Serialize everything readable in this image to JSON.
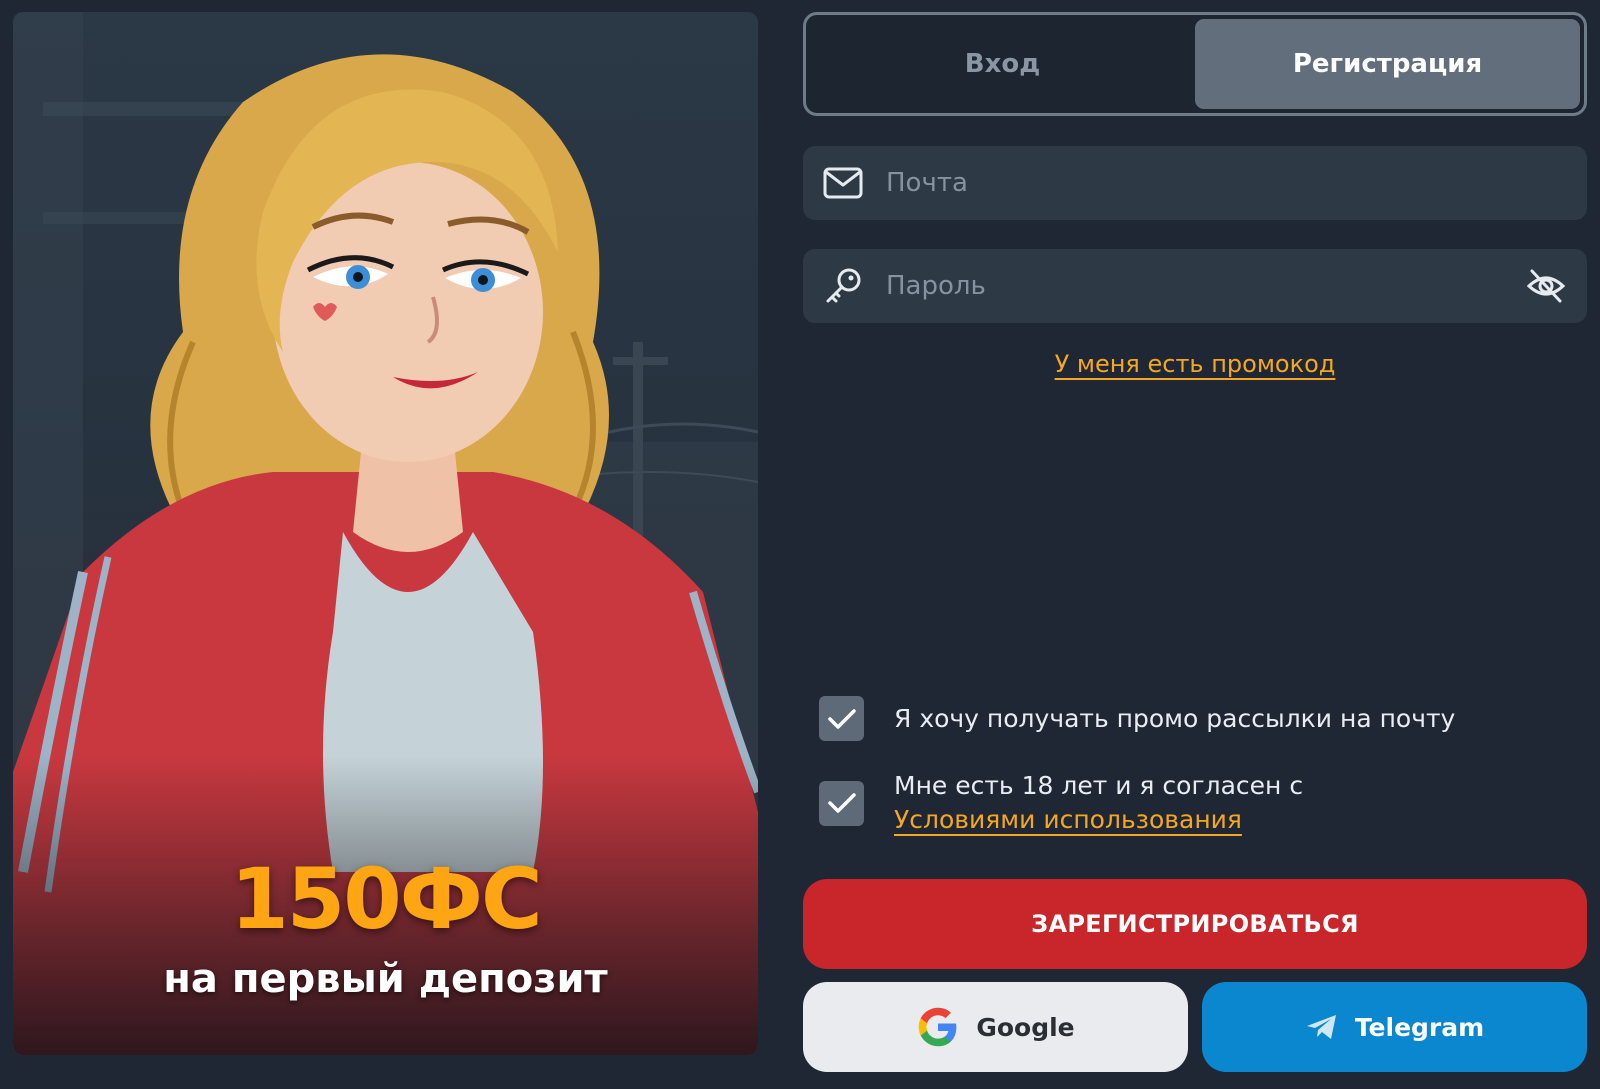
{
  "promo": {
    "amount": "150ФС",
    "subtitle": "на первый депозит"
  },
  "tabs": {
    "login": "Вход",
    "register": "Регистрация",
    "active": "register"
  },
  "fields": {
    "email": {
      "placeholder": "Почта",
      "value": "",
      "icon": "mail-icon"
    },
    "password": {
      "placeholder": "Пароль",
      "value": "",
      "icon": "key-icon",
      "toggle_icon": "eye-off-icon"
    }
  },
  "promo_code_link": "У меня есть промокод",
  "checkboxes": [
    {
      "label": "Я хочу получать промо рассылки на почту",
      "checked": true
    },
    {
      "label": "Мне есть 18 лет и я согласен с",
      "link": "Условиями использования",
      "checked": true
    }
  ],
  "buttons": {
    "register": "ЗАРЕГИСТРИРОВАТЬСЯ",
    "google": "Google",
    "telegram": "Telegram"
  },
  "colors": {
    "background": "#1e2733",
    "accent_orange": "#f5a623",
    "register_red": "#c9262b",
    "telegram_blue": "#0a87cf"
  }
}
